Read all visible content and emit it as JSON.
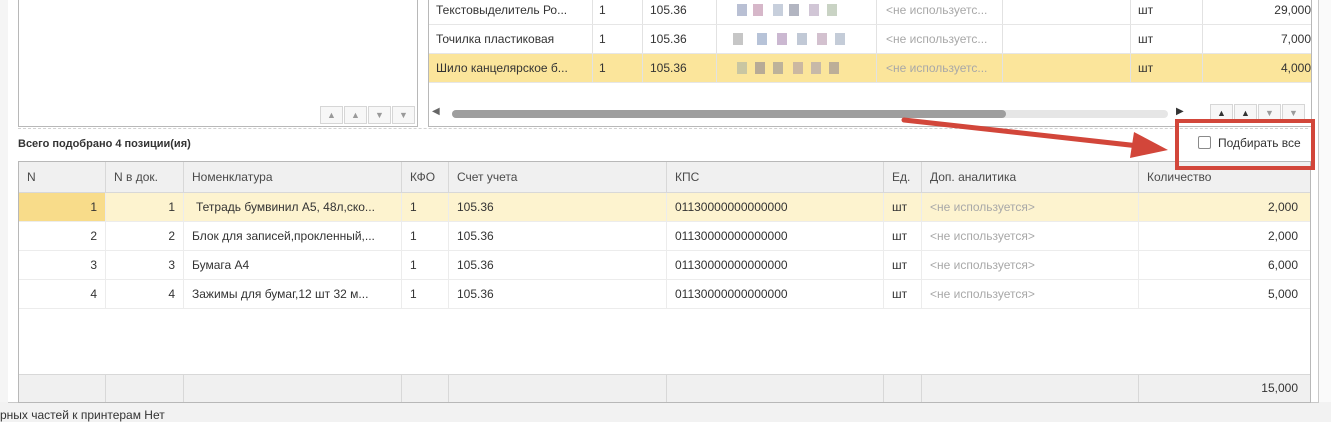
{
  "top_table": {
    "rows": [
      {
        "name": "Текстовыделитель Ро...",
        "kfo": "1",
        "account": "105.36",
        "analytics": "<не используетс...",
        "unit": "шт",
        "qty": "29,000",
        "selected": false
      },
      {
        "name": "Точилка пластиковая",
        "kfo": "1",
        "account": "105.36",
        "analytics": "<не используетс...",
        "unit": "шт",
        "qty": "7,000",
        "selected": false
      },
      {
        "name": "Шило канцелярское б...",
        "kfo": "1",
        "account": "105.36",
        "analytics": "<не используетс...",
        "unit": "шт",
        "qty": "4,000",
        "selected": true
      }
    ]
  },
  "total_label": "Всего подобрано 4 позиции(ия)",
  "pick_all": {
    "label": "Подбирать все",
    "checked": false
  },
  "bottom_table": {
    "columns": [
      "N",
      "N в док.",
      "Номенклатура",
      "КФО",
      "Счет учета",
      "КПС",
      "Ед.",
      "Доп. аналитика",
      "Количество"
    ],
    "rows": [
      {
        "n": "1",
        "n_doc": "1",
        "name": "Тетрадь бумвинил А5, 48л,ско...",
        "kfo": "1",
        "account": "105.36",
        "kps": "01130000000000000",
        "unit": "шт",
        "analytics": "<не используется>",
        "qty": "2,000",
        "selected": true
      },
      {
        "n": "2",
        "n_doc": "2",
        "name": "Блок для записей,прокленный,...",
        "kfo": "1",
        "account": "105.36",
        "kps": "01130000000000000",
        "unit": "шт",
        "analytics": "<не используется>",
        "qty": "2,000",
        "selected": false
      },
      {
        "n": "3",
        "n_doc": "3",
        "name": "Бумага А4",
        "kfo": "1",
        "account": "105.36",
        "kps": "01130000000000000",
        "unit": "шт",
        "analytics": "<не используется>",
        "qty": "6,000",
        "selected": false
      },
      {
        "n": "4",
        "n_doc": "4",
        "name": "Зажимы для бумаг,12 шт 32 м...",
        "kfo": "1",
        "account": "105.36",
        "kps": "01130000000000000",
        "unit": "шт",
        "analytics": "<не используется>",
        "qty": "5,000",
        "selected": false
      }
    ],
    "total_qty": "15,000"
  },
  "background_text": "рных частей к принтерам  Нет",
  "colors": {
    "selection": "#fbe59b",
    "annotation": "#d2463a",
    "header_bg": "#f0f0f0"
  },
  "icons": [
    "first-page-icon",
    "page-up-icon",
    "page-down-icon",
    "last-page-icon",
    "scroll-left-icon",
    "scroll-right-icon"
  ]
}
